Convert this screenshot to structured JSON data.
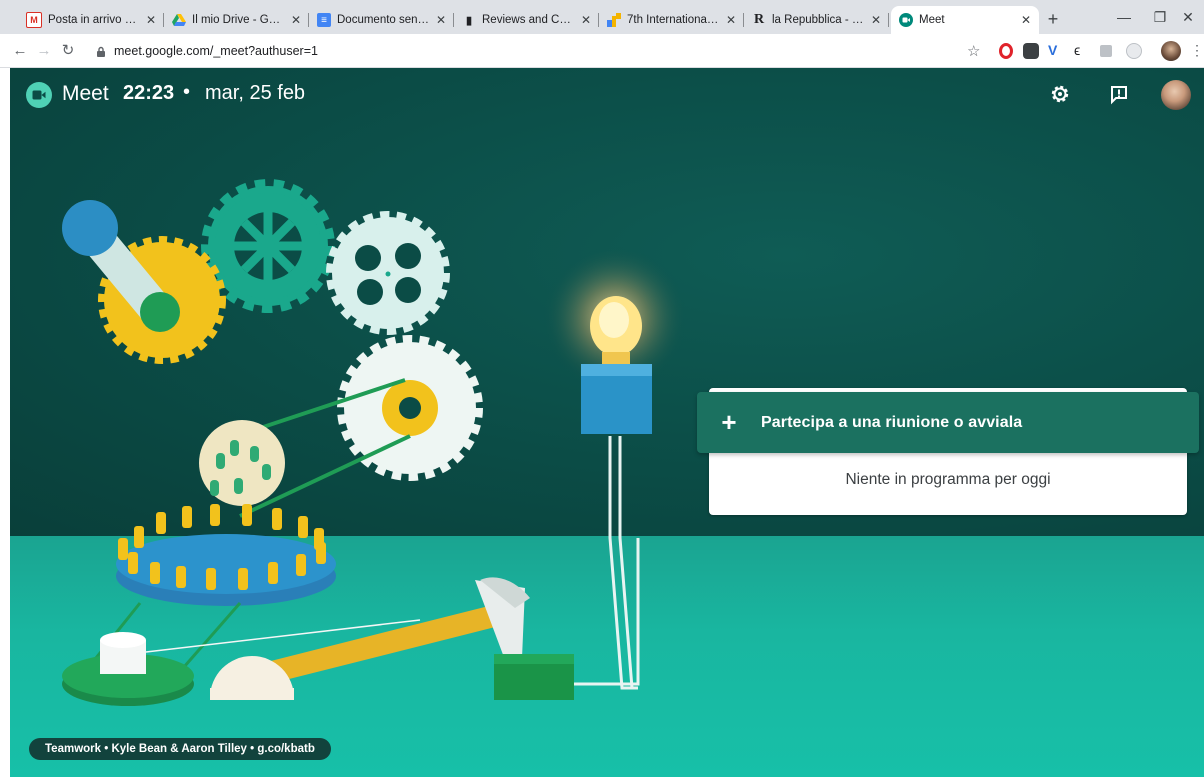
{
  "browser": {
    "tabs": [
      {
        "title": "Posta in arrivo (362) -",
        "icon": "gmail-icon",
        "color": "#d93025"
      },
      {
        "title": "Il mio Drive - Google D",
        "icon": "drive-icon",
        "color": "#1fa463"
      },
      {
        "title": "Documento senza titol",
        "icon": "docs-icon",
        "color": "#4285f4"
      },
      {
        "title": "Reviews and Commen",
        "icon": "review-icon",
        "color": "#202124"
      },
      {
        "title": "7th International Confe",
        "icon": "conference-icon",
        "color": "#f4b400"
      },
      {
        "title": "la Repubblica - News",
        "icon": "repubblica-icon",
        "color": "#202124"
      },
      {
        "title": "Meet",
        "icon": "meet-icon",
        "color": "#00897b"
      }
    ],
    "url": "meet.google.com/_meet?authuser=1"
  },
  "meet": {
    "app_name": "Meet",
    "time": "22:23",
    "separator": "•",
    "date": "mar, 25 feb",
    "join_label": "Partecipa a una riunione o avviala",
    "empty_agenda": "Niente in programma per oggi",
    "credit": "Teamwork • Kyle Bean & Aaron Tilley • g.co/kbatb"
  },
  "colors": {
    "wall": "#0b4c46",
    "floor": "#19b6a0",
    "join_button": "#1b7160"
  }
}
